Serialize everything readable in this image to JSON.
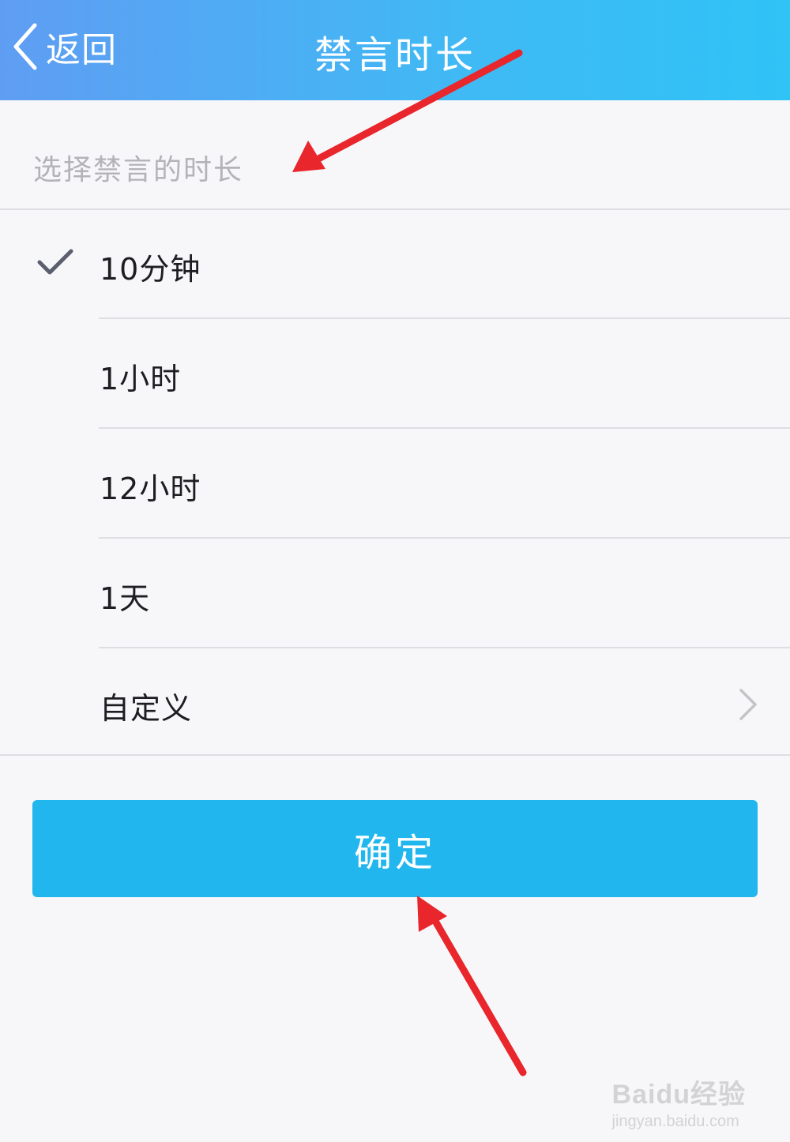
{
  "header": {
    "back_label": "返回",
    "title": "禁言时长"
  },
  "section": {
    "hint": "选择禁言的时长"
  },
  "options": [
    {
      "label": "10分钟",
      "selected": true
    },
    {
      "label": "1小时",
      "selected": false
    },
    {
      "label": "12小时",
      "selected": false
    },
    {
      "label": "1天",
      "selected": false
    },
    {
      "label": "自定义",
      "selected": false,
      "has_chevron": true
    }
  ],
  "confirm_label": "确定",
  "icons": {
    "back": "chevron-left-icon",
    "check": "checkmark-icon",
    "chevron": "chevron-right-icon"
  },
  "colors": {
    "header_start": "#5f9df3",
    "header_end": "#2fc3f6",
    "button": "#21b7ee",
    "annotation_arrow": "#e8262b"
  },
  "watermark": {
    "brand": "Baidu经验",
    "url": "jingyan.baidu.com"
  }
}
